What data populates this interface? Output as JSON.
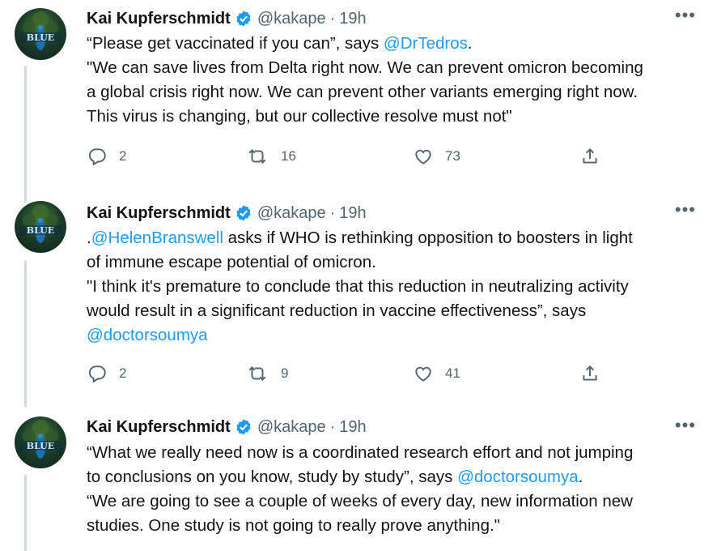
{
  "tweets": [
    {
      "name": "Kai Kupferschmidt",
      "handle": "@kakape",
      "separator": "·",
      "time": "19h",
      "more": "•••",
      "avatar_text": "BLUE",
      "lines": [
        {
          "segments": [
            {
              "t": "“Please get vaccinated if you can”, says "
            },
            {
              "t": "@DrTedros",
              "mention": true
            },
            {
              "t": "."
            }
          ]
        },
        {
          "segments": [
            {
              "t": "\"We can save lives from Delta right now. We can prevent omicron becoming"
            }
          ]
        },
        {
          "segments": [
            {
              "t": "a global crisis right now. We can prevent other variants emerging right now."
            }
          ]
        },
        {
          "segments": [
            {
              "t": "This virus is changing, but our collective resolve must not\""
            }
          ]
        }
      ],
      "replies": "2",
      "retweets": "16",
      "likes": "73"
    },
    {
      "name": "Kai Kupferschmidt",
      "handle": "@kakape",
      "separator": "·",
      "time": "19h",
      "more": "•••",
      "avatar_text": "BLUE",
      "lines": [
        {
          "segments": [
            {
              "t": "."
            },
            {
              "t": "@HelenBranswell",
              "mention": true
            },
            {
              "t": " asks if WHO is rethinking opposition to boosters in light"
            }
          ]
        },
        {
          "segments": [
            {
              "t": "of immune escape potential of omicron."
            }
          ]
        },
        {
          "segments": [
            {
              "t": "\"I think it's premature to conclude that this reduction in neutralizing activity"
            }
          ]
        },
        {
          "segments": [
            {
              "t": "would result in a significant reduction in vaccine effectiveness”, says"
            }
          ]
        },
        {
          "segments": [
            {
              "t": "@doctorsoumya",
              "mention": true
            }
          ]
        }
      ],
      "replies": "2",
      "retweets": "9",
      "likes": "41"
    },
    {
      "name": "Kai Kupferschmidt",
      "handle": "@kakape",
      "separator": "·",
      "time": "19h",
      "more": "•••",
      "avatar_text": "BLUE",
      "lines": [
        {
          "segments": [
            {
              "t": "“What we really need now is a coordinated research effort and not jumping"
            }
          ]
        },
        {
          "segments": [
            {
              "t": "to conclusions on you know, study by study”, says "
            },
            {
              "t": "@doctorsoumya",
              "mention": true
            },
            {
              "t": "."
            }
          ]
        },
        {
          "segments": [
            {
              "t": "“We are going to see a couple of weeks of every day, new information new"
            }
          ]
        },
        {
          "segments": [
            {
              "t": "studies. One study is not going to really prove anything.\""
            }
          ]
        }
      ]
    }
  ],
  "colors": {
    "accent": "#1d9bf0",
    "muted": "#536471",
    "text": "#0f1419",
    "thread": "#cfd9de"
  },
  "icons": [
    "reply-icon",
    "retweet-icon",
    "like-icon",
    "share-icon",
    "verified-badge-icon",
    "more-icon"
  ]
}
